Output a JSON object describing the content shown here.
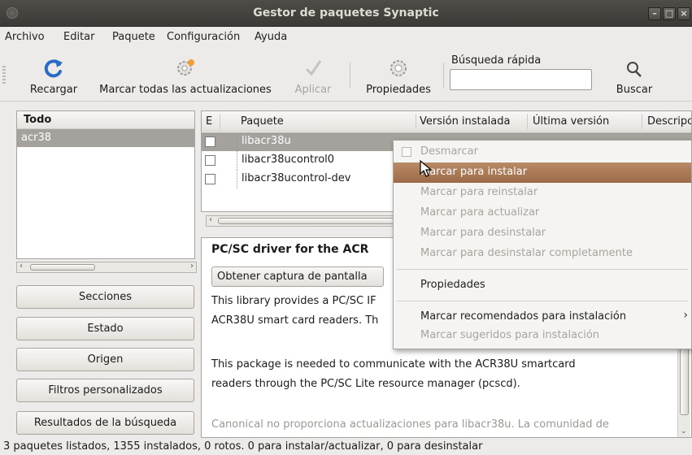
{
  "window": {
    "title": "Gestor de paquetes Synaptic"
  },
  "menubar": {
    "items": [
      {
        "label": "Archivo"
      },
      {
        "label": "Editar"
      },
      {
        "label": "Paquete"
      },
      {
        "label": "Configuración"
      },
      {
        "label": "Ayuda"
      }
    ]
  },
  "toolbar": {
    "reload_label": "Recargar",
    "mark_all_label": "Marcar todas las actualizaciones",
    "apply_label": "Aplicar",
    "properties_label": "Propiedades",
    "quick_search_label": "Búsqueda rápida",
    "quick_search_value": "",
    "search_label": "Buscar"
  },
  "filters": {
    "header": "Todo",
    "items": [
      "acr38"
    ]
  },
  "side_buttons": {
    "sections": "Secciones",
    "status": "Estado",
    "origin": "Origen",
    "custom_filters": "Filtros personalizados",
    "search_results": "Resultados de la búsqueda"
  },
  "packages": {
    "columns": [
      "E",
      "Paquete",
      "Versión instalada",
      "Última versión",
      "Descripción"
    ],
    "rows": [
      {
        "name": "libacr38u",
        "selected": true
      },
      {
        "name": "libacr38ucontrol0",
        "selected": false
      },
      {
        "name": "libacr38ucontrol-dev",
        "selected": false
      }
    ]
  },
  "description": {
    "title": "PC/SC driver for the ACR",
    "screenshot_button": "Obtener captura de pantalla",
    "line1": "This library provides a PC/SC IF",
    "line2": "ACR38U smart card readers. Th",
    "line3": "This package is needed to communicate with the ACR38U smartcard",
    "line4": "readers through the PC/SC Lite resource manager (pcscd).",
    "line5": "Canonical no proporciona actualizaciones para libacr38u. La comunidad de"
  },
  "context_menu": {
    "items": [
      {
        "label": "Desmarcar",
        "state": "disabled"
      },
      {
        "label": "Marcar para instalar",
        "state": "highlighted"
      },
      {
        "label": "Marcar para reinstalar",
        "state": "disabled"
      },
      {
        "label": "Marcar para actualizar",
        "state": "disabled"
      },
      {
        "label": "Marcar para desinstalar",
        "state": "disabled"
      },
      {
        "label": "Marcar para desinstalar completamente",
        "state": "disabled"
      },
      {
        "label": "Propiedades",
        "state": "enabled"
      },
      {
        "label": "Marcar recomendados para instalación",
        "state": "enabled"
      },
      {
        "label": "Marcar sugeridos para instalación",
        "state": "disabled"
      }
    ]
  },
  "statusbar": {
    "text": "3 paquetes listados, 1355 instalados, 0 rotos. 0 para instalar/actualizar, 0 para desinstalar"
  },
  "colors": {
    "titlebar": "#3b3a36",
    "selection": "#a5a19c",
    "menu_highlight": "#ad7c5a"
  }
}
